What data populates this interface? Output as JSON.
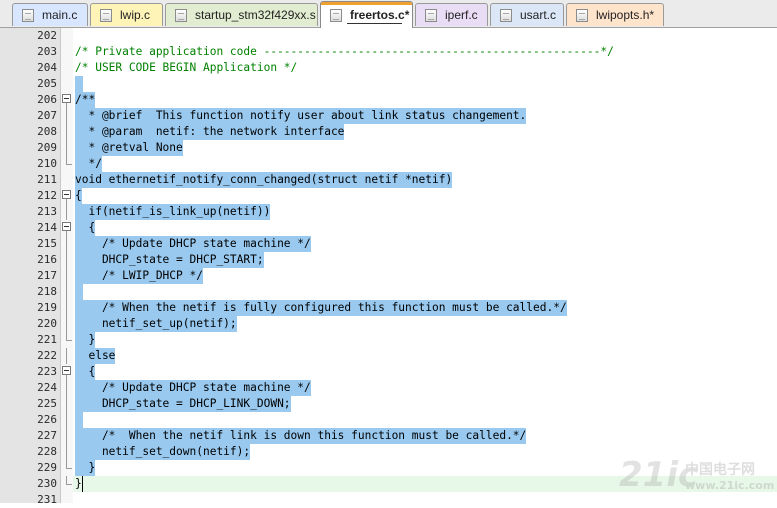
{
  "tabs": [
    {
      "label": "main.c",
      "color": "#d9e6ff",
      "active": false
    },
    {
      "label": "lwip.c",
      "color": "#fff4b8",
      "active": false
    },
    {
      "label": "startup_stm32f429xx.s",
      "color": "#e2ecd0",
      "active": false
    },
    {
      "label": "freertos.c*",
      "color": "#ffffff",
      "active": true
    },
    {
      "label": "iperf.c",
      "color": "#e8ddf5",
      "active": false
    },
    {
      "label": "usart.c",
      "color": "#dbe6f7",
      "active": false
    },
    {
      "label": "lwipopts.h*",
      "color": "#ffe4cc",
      "active": false
    }
  ],
  "editor": {
    "selection_color": "#99c9ef",
    "comment_color": "#008000",
    "lines": [
      {
        "num": "202",
        "text": "",
        "kind": "plain",
        "fold": "none"
      },
      {
        "num": "203",
        "text": "/* Private application code --------------------------------------------------*/",
        "kind": "comment",
        "fold": "none"
      },
      {
        "num": "204",
        "text": "/* USER CODE BEGIN Application */",
        "kind": "comment",
        "fold": "none"
      },
      {
        "num": "205",
        "text": "",
        "kind": "sel",
        "fold": "none"
      },
      {
        "num": "206",
        "text": "/**",
        "kind": "sel",
        "fold": "open"
      },
      {
        "num": "207",
        "text": "  * @brief  This function notify user about link status changement.",
        "kind": "sel",
        "fold": "line"
      },
      {
        "num": "208",
        "text": "  * @param  netif: the network interface",
        "kind": "sel",
        "fold": "line"
      },
      {
        "num": "209",
        "text": "  * @retval None",
        "kind": "sel",
        "fold": "line"
      },
      {
        "num": "210",
        "text": "  */",
        "kind": "sel",
        "fold": "end"
      },
      {
        "num": "211",
        "text": "void ethernetif_notify_conn_changed(struct netif *netif)",
        "kind": "sel",
        "fold": "none"
      },
      {
        "num": "212",
        "text": "{",
        "kind": "sel",
        "fold": "open"
      },
      {
        "num": "213",
        "text": "  if(netif_is_link_up(netif))",
        "kind": "sel",
        "fold": "line"
      },
      {
        "num": "214",
        "text": "  {",
        "kind": "sel",
        "fold": "open"
      },
      {
        "num": "215",
        "text": "    /* Update DHCP state machine */",
        "kind": "sel",
        "fold": "line"
      },
      {
        "num": "216",
        "text": "    DHCP_state = DHCP_START;",
        "kind": "sel",
        "fold": "line"
      },
      {
        "num": "217",
        "text": "    /* LWIP_DHCP */",
        "kind": "sel",
        "fold": "line"
      },
      {
        "num": "218",
        "text": "",
        "kind": "sel",
        "fold": "line"
      },
      {
        "num": "219",
        "text": "    /* When the netif is fully configured this function must be called.*/",
        "kind": "sel",
        "fold": "line"
      },
      {
        "num": "220",
        "text": "    netif_set_up(netif);",
        "kind": "sel",
        "fold": "line"
      },
      {
        "num": "221",
        "text": "  }",
        "kind": "sel",
        "fold": "end"
      },
      {
        "num": "222",
        "text": "  else",
        "kind": "sel",
        "fold": "line"
      },
      {
        "num": "223",
        "text": "  {",
        "kind": "sel",
        "fold": "open"
      },
      {
        "num": "224",
        "text": "    /* Update DHCP state machine */",
        "kind": "sel",
        "fold": "line"
      },
      {
        "num": "225",
        "text": "    DHCP_state = DHCP_LINK_DOWN;",
        "kind": "sel",
        "fold": "line"
      },
      {
        "num": "226",
        "text": "",
        "kind": "sel",
        "fold": "line"
      },
      {
        "num": "227",
        "text": "    /*  When the netif link is down this function must be called.*/",
        "kind": "sel",
        "fold": "line"
      },
      {
        "num": "228",
        "text": "    netif_set_down(netif);",
        "kind": "sel",
        "fold": "line"
      },
      {
        "num": "229",
        "text": "  }",
        "kind": "sel",
        "fold": "end"
      },
      {
        "num": "230",
        "text": "}",
        "kind": "current",
        "fold": "end"
      },
      {
        "num": "231",
        "text": "",
        "kind": "plain",
        "fold": "none"
      }
    ]
  },
  "watermark": {
    "big": "21ic",
    "cn": "中国电子网",
    "url": "www.21ic.com"
  }
}
